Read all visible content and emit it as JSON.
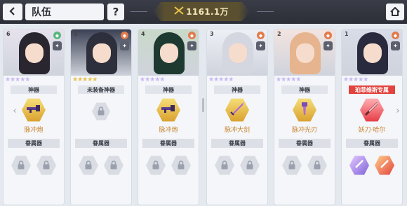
{
  "header": {
    "title": "队伍",
    "help_label": "?",
    "power": "1161.1万"
  },
  "labels": {
    "equipment_section": "眷属器"
  },
  "cards": [
    {
      "slot": "6",
      "weapon_tag": "神器",
      "weapon_tag_style": "normal",
      "weapon_name": "脉冲炮",
      "weapon": "gold",
      "weapon_glyph": "gun",
      "subs": [
        "locked",
        "locked"
      ],
      "hair": "#2a2630",
      "bg": "#e6e2ee",
      "elem": "#57b87d",
      "stars_purple": 5,
      "stars_gold": 0
    },
    {
      "slot": "5",
      "weapon_tag": "未装备神器",
      "weapon_tag_style": "normal",
      "weapon_name": "",
      "weapon": "empty",
      "weapon_glyph": "lock",
      "subs": [
        "locked",
        "locked"
      ],
      "hair": "#2e2f3d",
      "bg": "#3b4154",
      "elem": "#e27b4c",
      "stars_purple": 0,
      "stars_gold": 5
    },
    {
      "slot": "4",
      "weapon_tag": "神器",
      "weapon_tag_style": "normal",
      "weapon_name": "脉冲炮",
      "weapon": "gold",
      "weapon_glyph": "gun",
      "subs": [
        "locked",
        "locked"
      ],
      "hair": "#1e3a30",
      "bg": "#c9d9c9",
      "elem": "#e27b4c",
      "stars_purple": 5,
      "stars_gold": 0
    },
    {
      "slot": "3",
      "weapon_tag": "神器",
      "weapon_tag_style": "normal",
      "weapon_name": "脉冲大剑",
      "weapon": "gold",
      "weapon_glyph": "sword",
      "subs": [
        "locked",
        "locked"
      ],
      "hair": "#d4d6e0",
      "bg": "#eef0f6",
      "elem": "#e27b4c",
      "stars_purple": 5,
      "stars_gold": 0
    },
    {
      "slot": "2",
      "weapon_tag": "神器",
      "weapon_tag_style": "normal",
      "weapon_name": "脉冲光刃",
      "weapon": "gold",
      "weapon_glyph": "blade",
      "subs": [
        "locked",
        "locked"
      ],
      "hair": "#e6b48e",
      "bg": "#f2e4e0",
      "elem": "#e27b4c",
      "stars_purple": 5,
      "stars_gold": 0
    },
    {
      "slot": "1",
      "weapon_tag": "珀菲维斯专属",
      "weapon_tag_style": "red",
      "weapon_name": "妖刀·哈尔",
      "weapon": "pink",
      "weapon_glyph": "katana",
      "subs": [
        "purple",
        "red"
      ],
      "hair": "#2a2a3e",
      "bg": "#d8dce8",
      "elem": "#e27b4c",
      "stars_purple": 5,
      "stars_gold": 0
    }
  ],
  "colors": {
    "accent_gold": "#e9c24a",
    "accent_red": "#e2433e",
    "topbar": "#2b2e37"
  },
  "icons": {
    "back": "back-arrow-icon",
    "home": "home-icon",
    "power": "crossed-swords-icon",
    "lock": "lock-icon"
  }
}
